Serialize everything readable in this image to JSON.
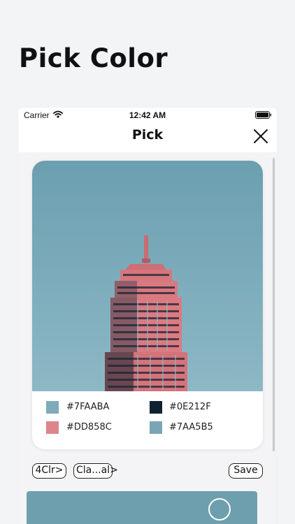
{
  "header": {
    "title": "Pick Color"
  },
  "status_bar": {
    "carrier": "Carrier",
    "time": "12:42 AM"
  },
  "nav": {
    "title": "Pick"
  },
  "swatches": [
    {
      "hex": "#7FAABA",
      "color": "#7FAABA"
    },
    {
      "hex": "#0E212F",
      "color": "#0E212F"
    },
    {
      "hex": "#DD858C",
      "color": "#DD858C"
    },
    {
      "hex": "#7AA5B5",
      "color": "#7AA5B5"
    }
  ],
  "toolbar": {
    "count_label": "4Clr>",
    "class_label": "Cla...al>",
    "save_label": "Save"
  },
  "icons": {
    "wifi": "wifi-icon",
    "battery": "battery-icon",
    "close": "close-icon"
  }
}
